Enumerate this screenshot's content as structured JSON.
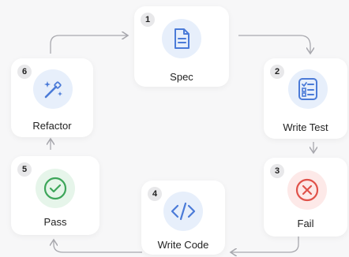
{
  "diagram": {
    "steps": [
      {
        "number": "1",
        "label": "Spec",
        "icon": "document-icon"
      },
      {
        "number": "2",
        "label": "Write Test",
        "icon": "checklist-icon"
      },
      {
        "number": "3",
        "label": "Fail",
        "icon": "x-circle-icon"
      },
      {
        "number": "4",
        "label": "Write Code",
        "icon": "code-icon"
      },
      {
        "number": "5",
        "label": "Pass",
        "icon": "check-circle-icon"
      },
      {
        "number": "6",
        "label": "Refactor",
        "icon": "magic-wand-icon"
      }
    ]
  },
  "colors": {
    "blue_accent": "#4b7bd8",
    "blue_bg": "#e7effb",
    "red_accent": "#e0524a",
    "red_bg": "#fde9e8",
    "green_accent": "#3da65a",
    "green_bg": "#e6f5ea",
    "arrow": "#a8a8ae"
  }
}
